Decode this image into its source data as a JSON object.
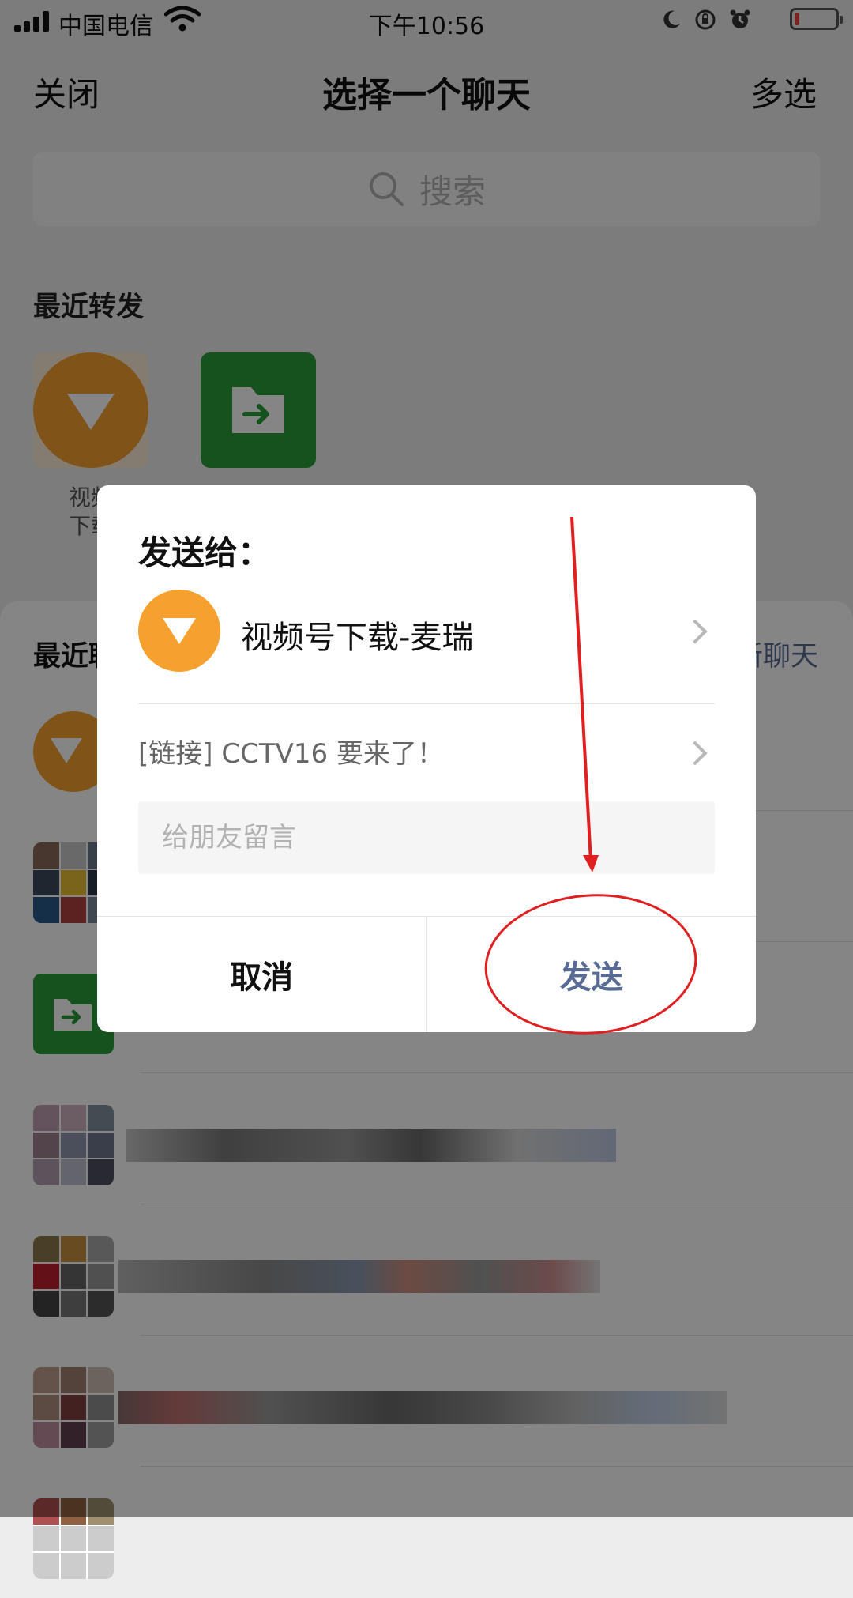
{
  "status_bar": {
    "carrier": "中国电信",
    "time": "下午10:56",
    "battery_level": 0.12
  },
  "nav": {
    "close_label": "关闭",
    "title": "选择一个聊天",
    "multi_select_label": "多选"
  },
  "search": {
    "placeholder": "搜索"
  },
  "recent_forwards": {
    "title": "最近转发",
    "items": [
      {
        "label": "视频\n下载",
        "icon": "video-download-icon"
      },
      {
        "label": "",
        "icon": "file-transfer-icon"
      }
    ]
  },
  "recent_chats": {
    "title": "最近聊天",
    "create_chat_label": "创建新聊天"
  },
  "dialog": {
    "title": "发送给：",
    "recipient_name": "视频号下载-麦瑞",
    "message_preview": "[链接] CCTV16 要来了！",
    "comment_placeholder": "给朋友留言",
    "cancel_label": "取消",
    "send_label": "发送"
  },
  "colors": {
    "accent_link": "#576b95",
    "orange": "#f5a02f",
    "green": "#2a9d3a",
    "annotation_red": "#e02020"
  }
}
